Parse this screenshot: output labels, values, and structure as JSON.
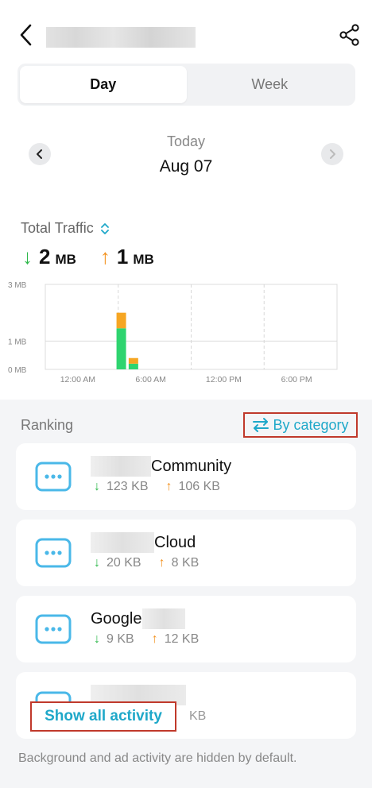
{
  "header": {
    "back_icon": "chevron-left-icon",
    "share_icon": "share-icon"
  },
  "tabs": [
    {
      "label": "Day",
      "active": true
    },
    {
      "label": "Week",
      "active": false
    }
  ],
  "date_nav": {
    "today_label": "Today",
    "date": "Aug 07"
  },
  "traffic": {
    "title": "Total Traffic",
    "download_value": "2",
    "download_unit": "MB",
    "upload_value": "1",
    "upload_unit": "MB"
  },
  "chart_data": {
    "type": "bar",
    "stacked": true,
    "ytick_labels": [
      "3 MB",
      "1 MB",
      "0 MB"
    ],
    "yticks": [
      3,
      1,
      0
    ],
    "ylim": [
      0,
      3
    ],
    "xtick_labels": [
      "12:00 AM",
      "6:00 AM",
      "12:00 PM",
      "6:00 PM"
    ],
    "x": [
      6.25,
      7.25
    ],
    "xlim": [
      0,
      24
    ],
    "series": [
      {
        "color": "#2ed46f",
        "values": [
          1.45,
          0.2
        ]
      },
      {
        "color": "#f6a623",
        "values": [
          0.55,
          0.2
        ]
      }
    ],
    "grid": true
  },
  "ranking": {
    "label": "Ranking",
    "filter_label": "By category",
    "filter_icon": "swap-arrows-icon",
    "items": [
      {
        "name": "Community",
        "down": "123 KB",
        "up": "106 KB"
      },
      {
        "name": "Cloud",
        "down": "20 KB",
        "up": "8 KB"
      },
      {
        "name": "Google",
        "down": "9 KB",
        "up": "12 KB"
      }
    ],
    "partial_item_stat": "KB"
  },
  "show_all_label": "Show all activity",
  "footer_note": "Background and ad activity are hidden by default.",
  "colors": {
    "accent": "#1fa8c9",
    "download": "#2db84a",
    "upload": "#f39220",
    "icon": "#4ab8e8"
  }
}
